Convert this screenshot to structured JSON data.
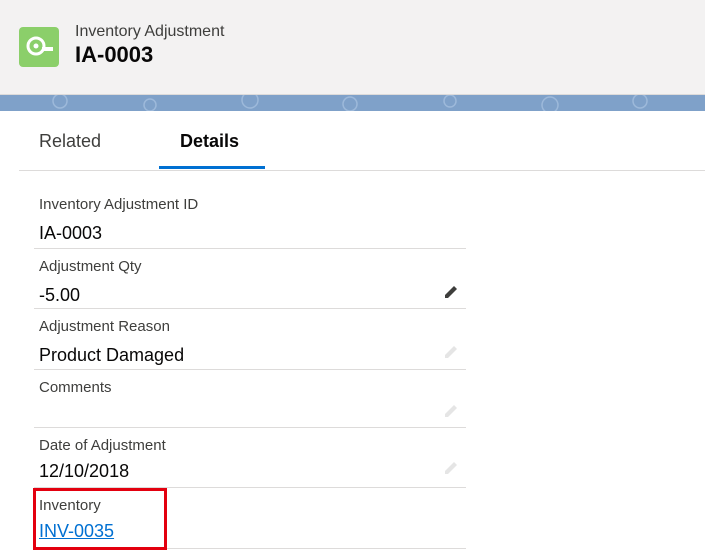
{
  "header": {
    "object_type": "Inventory Adjustment",
    "record_name": "IA-0003",
    "icon": "tape-measure-icon",
    "icon_color": "#8bcf6a"
  },
  "tabs": [
    {
      "label": "Related",
      "active": false
    },
    {
      "label": "Details",
      "active": true
    }
  ],
  "fields": [
    {
      "label": "Inventory Adjustment ID",
      "value": "IA-0003",
      "editable": false
    },
    {
      "label": "Adjustment Qty",
      "value": "-5.00",
      "editable": true
    },
    {
      "label": "Adjustment Reason",
      "value": "Product Damaged",
      "editable": true
    },
    {
      "label": "Comments",
      "value": "",
      "editable": true
    },
    {
      "label": "Date of Adjustment",
      "value": "12/10/2018",
      "editable": true
    },
    {
      "label": "Inventory",
      "value": "INV-0035",
      "link": true
    }
  ],
  "colors": {
    "accent": "#0070d2",
    "highlight": "#e3000f"
  }
}
